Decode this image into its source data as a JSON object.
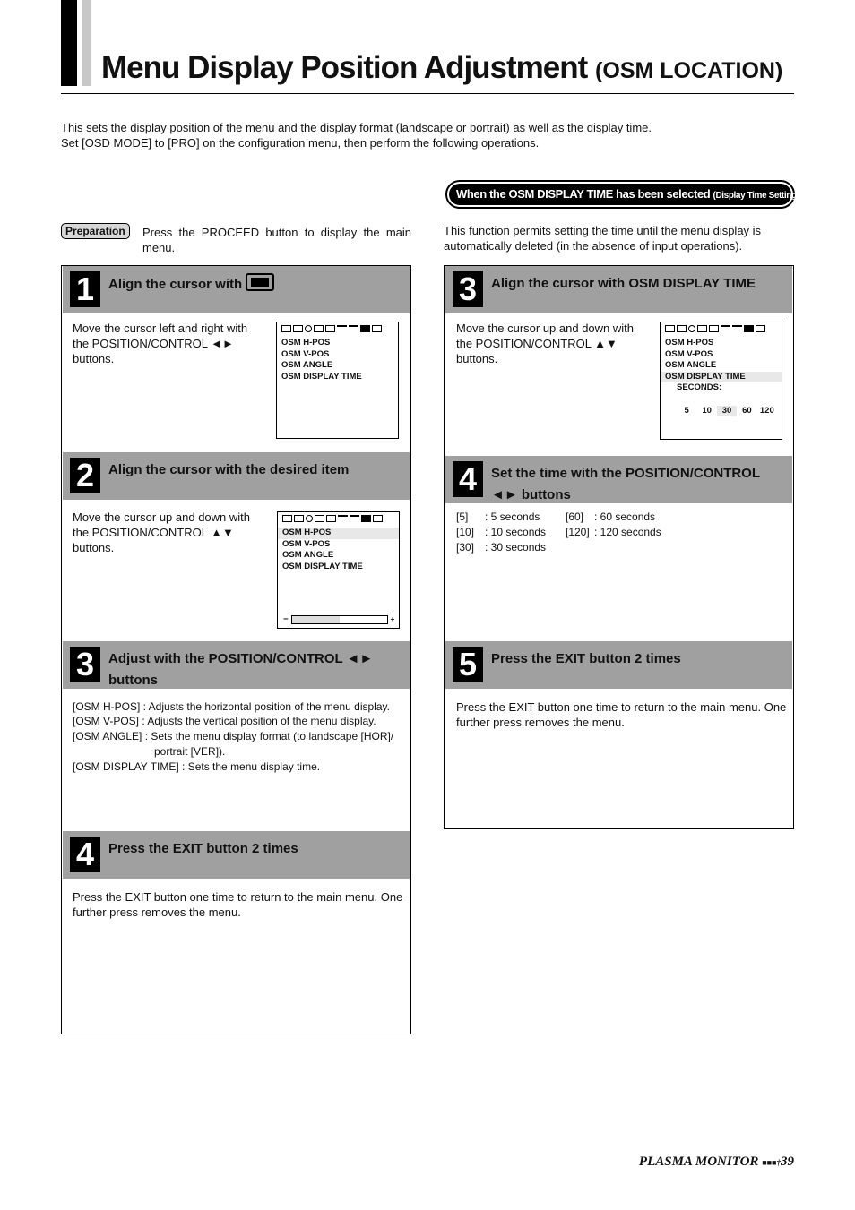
{
  "header": {
    "title": "Menu Display Position Adjustment",
    "subtitle": "(OSM LOCATION)"
  },
  "intro": [
    "This sets the display position of the menu and the display format (landscape or portrait) as well as the display time.",
    "Set [OSD MODE] to [PRO] on the configuration menu, then perform the following operations."
  ],
  "preparation": {
    "badge": "Preparation",
    "text": "Press the PROCEED button to display the main menu."
  },
  "right_banner": {
    "main": "When the OSM DISPLAY TIME has been selected",
    "small": "(Display Time Setting)"
  },
  "right_intro": "This function permits setting the time until the menu display is automatically deleted (in the absence of input operations).",
  "osd": {
    "items": [
      "OSM H-POS",
      "OSM V-POS",
      "OSM ANGLE",
      "OSM DISPLAY TIME"
    ],
    "seconds_label": "SECONDS:",
    "seconds": [
      "5",
      "10",
      "30",
      "60",
      "120"
    ],
    "selected_seconds": "30",
    "slider_minus": "−",
    "slider_plus": "+",
    "slider_level": 0.5
  },
  "left_steps": [
    {
      "num": "1",
      "title": "Align the cursor with",
      "icon": "monitor-icon",
      "body": "Move the cursor left and right with the POSITION/CONTROL ◄► buttons."
    },
    {
      "num": "2",
      "title": "Align the cursor with the desired item",
      "body": "Move the cursor up and down with the POSITION/CONTROL ▲▼ buttons."
    },
    {
      "num": "3",
      "title": "Adjust with the POSITION/CONTROL ◄► buttons",
      "body_lines": [
        "[OSM H-POS]  :  Adjusts the horizontal position of the menu display.",
        "[OSM V-POS]  :  Adjusts the vertical position of the menu display.",
        "[OSM ANGLE] :  Sets the menu display format (to landscape [HOR]/",
        "portrait [VER]).",
        "[OSM DISPLAY TIME] : Sets the menu display time."
      ]
    },
    {
      "num": "4",
      "title": "Press the EXIT button 2 times",
      "body": "Press the EXIT button one time to return to the main menu. One further press removes the menu."
    }
  ],
  "right_steps": [
    {
      "num": "3",
      "title": "Align the cursor with OSM DISPLAY TIME",
      "body": "Move the cursor up and down with the POSITION/CONTROL ▲▼ buttons."
    },
    {
      "num": "4",
      "title": "Set the time with the POSITION/CONTROL ◄► buttons",
      "table": [
        [
          "[5]",
          ":  5 seconds",
          "[60]",
          ":  60 seconds"
        ],
        [
          "[10]",
          ":  10 seconds",
          "[120]",
          ":  120 seconds"
        ],
        [
          "[30]",
          ":  30 seconds",
          "",
          ""
        ]
      ]
    },
    {
      "num": "5",
      "title": "Press the EXIT button 2 times",
      "body": "Press the EXIT button one time to return to the main menu. One further press removes the menu."
    }
  ],
  "footer": {
    "label": "PLASMA MONITOR",
    "page": "39"
  }
}
